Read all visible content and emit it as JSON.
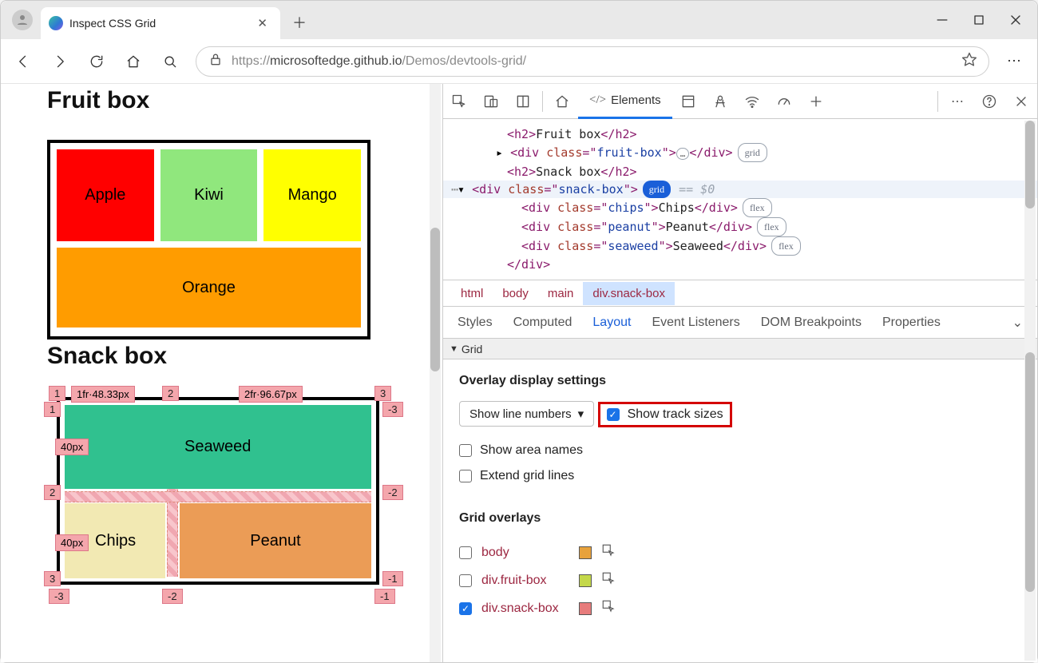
{
  "tab": {
    "title": "Inspect CSS Grid"
  },
  "url": {
    "left": "https://",
    "host": "microsoftedge.github.io",
    "path": "/Demos/devtools-grid/"
  },
  "page": {
    "h1": "Fruit box",
    "fruit": {
      "apple": "Apple",
      "kiwi": "Kiwi",
      "mango": "Mango",
      "orange": "Orange"
    },
    "h2": "Snack box",
    "snack": {
      "seaweed": "Seaweed",
      "chips": "Chips",
      "peanut": "Peanut"
    },
    "overlay": {
      "col1": "1fr·48.33px",
      "col2": "2fr·96.67px",
      "row1": "40px",
      "row2": "40px",
      "n1": "1",
      "n2": "2",
      "n3": "3",
      "nm1": "-1",
      "nm2": "-2",
      "nm3": "-3"
    }
  },
  "dt": {
    "elements": "Elements",
    "dom": {
      "l1a": "<h2>",
      "l1b": "Fruit box",
      "l1c": "</h2>",
      "l2a": "<div ",
      "l2b": "class",
      "l2c": "=\"",
      "l2d": "fruit-box",
      "l2e": "\">",
      "l2f": "</div>",
      "l2badge": "grid",
      "l2ell": "…",
      "l3a": "<h2>",
      "l3b": "Snack box",
      "l3c": "</h2>",
      "l4a": "<div ",
      "l4b": "class",
      "l4c": "=\"",
      "l4d": "snack-box",
      "l4e": "\">",
      "l4badge": "grid",
      "l4eq": "== $0",
      "l5a": "<div ",
      "l5b": "class",
      "l5c": "=\"",
      "l5d": "chips",
      "l5e": "\">",
      "l5t": "Chips",
      "l5f": "</div>",
      "l5badge": "flex",
      "l6a": "<div ",
      "l6b": "class",
      "l6c": "=\"",
      "l6d": "peanut",
      "l6e": "\">",
      "l6t": "Peanut",
      "l6f": "</div>",
      "l6badge": "flex",
      "l7a": "<div ",
      "l7b": "class",
      "l7c": "=\"",
      "l7d": "seaweed",
      "l7e": "\">",
      "l7t": "Seaweed",
      "l7f": "</div>",
      "l7badge": "flex",
      "l8": "</div>"
    },
    "crumbs": {
      "c1": "html",
      "c2": "body",
      "c3": "main",
      "c4": "div.snack-box"
    },
    "panels": {
      "styles": "Styles",
      "computed": "Computed",
      "layout": "Layout",
      "events": "Event Listeners",
      "dom": "DOM Breakpoints",
      "props": "Properties"
    },
    "grid": {
      "header": "Grid",
      "overlay_h": "Overlay display settings",
      "dd": "Show line numbers",
      "cb1": "Show track sizes",
      "cb2": "Show area names",
      "cb3": "Extend grid lines",
      "ov_h": "Grid overlays",
      "ov1": "body",
      "ov2": "div.fruit-box",
      "ov3": "div.snack-box",
      "c1": "#e8a23c",
      "c2": "#c4d84a",
      "c3": "#e77c7c"
    }
  }
}
